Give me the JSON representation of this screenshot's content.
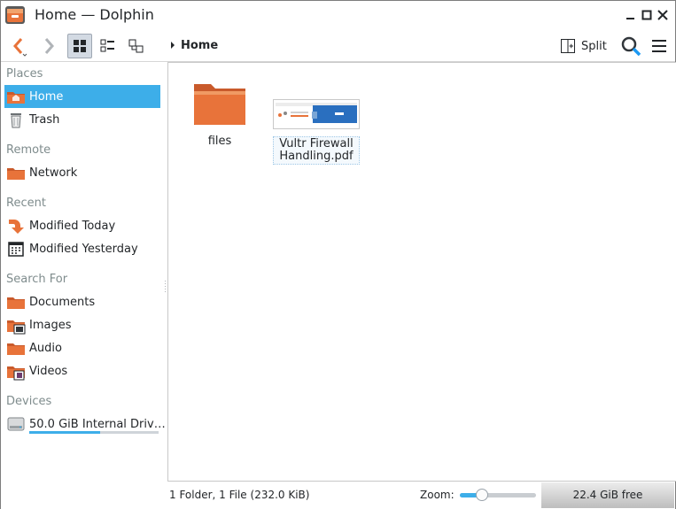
{
  "window": {
    "title": "Home — Dolphin"
  },
  "toolbar": {
    "breadcrumb": "Home",
    "split_label": "Split",
    "icons": [
      "back-icon",
      "forward-icon",
      "icons-view-icon",
      "compact-view-icon",
      "details-view-icon",
      "split-icon",
      "search-icon",
      "menu-icon"
    ]
  },
  "sidebar": {
    "places_header": "Places",
    "places": [
      {
        "label": "Home",
        "icon": "home-folder-icon",
        "selected": true
      },
      {
        "label": "Trash",
        "icon": "trash-icon"
      }
    ],
    "remote_header": "Remote",
    "remote": [
      {
        "label": "Network",
        "icon": "network-folder-icon"
      }
    ],
    "recent_header": "Recent",
    "recent": [
      {
        "label": "Modified Today",
        "icon": "recent-arrow-icon"
      },
      {
        "label": "Modified Yesterday",
        "icon": "calendar-icon"
      }
    ],
    "search_header": "Search For",
    "search": [
      {
        "label": "Documents",
        "icon": "documents-folder-icon"
      },
      {
        "label": "Images",
        "icon": "images-folder-icon"
      },
      {
        "label": "Audio",
        "icon": "audio-folder-icon"
      },
      {
        "label": "Videos",
        "icon": "videos-folder-icon"
      }
    ],
    "devices_header": "Devices",
    "devices": [
      {
        "label": "50.0 GiB Internal Driv…",
        "icon": "drive-icon",
        "usage_fraction": 0.55
      }
    ]
  },
  "files": [
    {
      "name": "files",
      "type": "folder"
    },
    {
      "name_line1": "Vultr Firewall",
      "name_line2": "Handling.pdf",
      "type": "pdf"
    }
  ],
  "status": {
    "summary": "1 Folder, 1 File (232.0 KiB)",
    "zoom_label": "Zoom:",
    "zoom_fraction": 0.29,
    "free_space": "22.4 GiB free"
  },
  "colors": {
    "accent": "#3daee9",
    "folder": "#e8733a"
  }
}
